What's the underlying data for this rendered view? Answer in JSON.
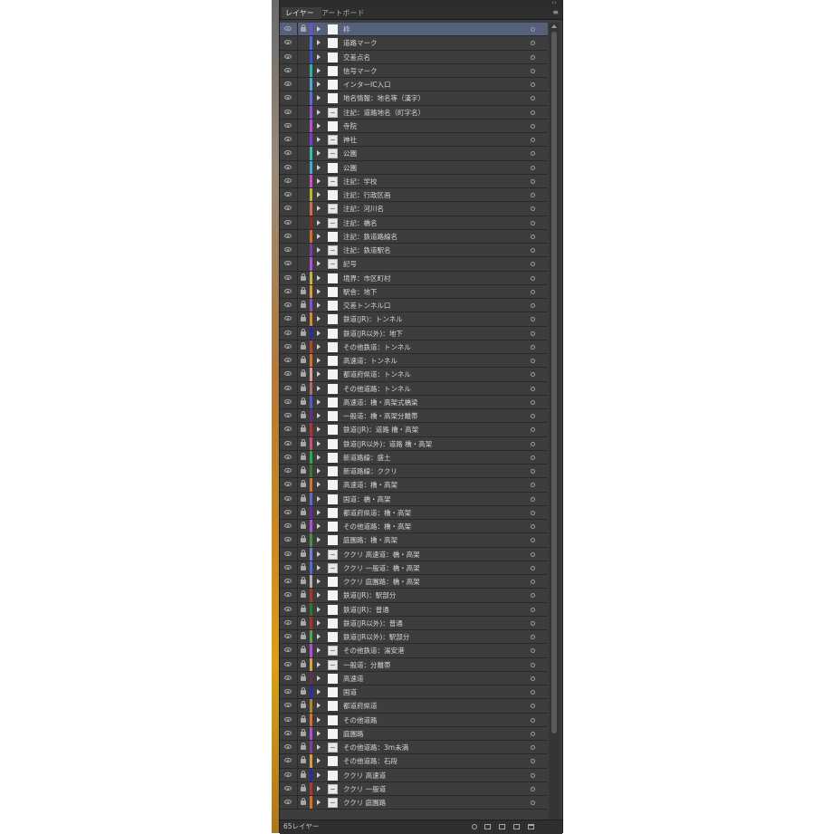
{
  "panel": {
    "tabs": [
      {
        "label": "レイヤー",
        "active": true
      },
      {
        "label": "アートボード",
        "active": false
      }
    ],
    "menu_icon": "panel-menu-icon",
    "footer": {
      "layer_count": "65レイヤー",
      "icons": [
        "search-icon",
        "clip-icon",
        "sublayer-icon",
        "new-layer-icon",
        "trash-icon"
      ]
    }
  },
  "layers": [
    {
      "name": "枠",
      "color": "#6a4fd1",
      "locked": true,
      "selected": true,
      "marked": false
    },
    {
      "name": "道路マーク",
      "color": "#4f6ad8",
      "locked": false,
      "selected": false,
      "marked": false
    },
    {
      "name": "交差点名",
      "color": "#3d4fd0",
      "locked": false,
      "selected": false,
      "marked": false
    },
    {
      "name": "信号マーク",
      "color": "#2fb5a8",
      "locked": false,
      "selected": false,
      "marked": false
    },
    {
      "name": "インターIC入口",
      "color": "#4fa5d6",
      "locked": false,
      "selected": false,
      "marked": false
    },
    {
      "name": "地名情報：地名等（漢字）",
      "color": "#5c6bd6",
      "locked": false,
      "selected": false,
      "marked": false
    },
    {
      "name": "注記：道路地名（町字名）",
      "color": "#9b4fd8",
      "locked": false,
      "selected": false,
      "marked": true
    },
    {
      "name": "寺院",
      "color": "#b74fd8",
      "locked": false,
      "selected": false,
      "marked": false
    },
    {
      "name": "神社",
      "color": "#7a3dd0",
      "locked": false,
      "selected": false,
      "marked": true
    },
    {
      "name": "公園",
      "color": "#35c0b0",
      "locked": false,
      "selected": false,
      "marked": true
    },
    {
      "name": "公園",
      "color": "#40a8d8",
      "locked": false,
      "selected": false,
      "marked": false
    },
    {
      "name": "注記：学校",
      "color": "#c84fd0",
      "locked": false,
      "selected": false,
      "marked": true
    },
    {
      "name": "注記：行政区画",
      "color": "#b8b82a",
      "locked": false,
      "selected": false,
      "marked": false
    },
    {
      "name": "注記：河川名",
      "color": "#d86a4f",
      "locked": false,
      "selected": false,
      "marked": true
    },
    {
      "name": "注記：橋名",
      "color": "#8a2a2a",
      "locked": false,
      "selected": false,
      "marked": true
    },
    {
      "name": "注記：鉄道路線名",
      "color": "#d06f2a",
      "locked": false,
      "selected": false,
      "marked": false
    },
    {
      "name": "注記：鉄道駅名",
      "color": "#7a3da0",
      "locked": false,
      "selected": false,
      "marked": true
    },
    {
      "name": "記号",
      "color": "#b04fd8",
      "locked": false,
      "selected": false,
      "marked": true
    },
    {
      "name": "境界：市区町村",
      "color": "#c8b43a",
      "locked": true,
      "selected": false,
      "marked": false
    },
    {
      "name": "駅舎：地下",
      "color": "#d89a3a",
      "locked": true,
      "selected": false,
      "marked": false
    },
    {
      "name": "交差トンネル口",
      "color": "#8a4fc0",
      "locked": true,
      "selected": false,
      "marked": false
    },
    {
      "name": "鉄道(JR)：トンネル",
      "color": "#d68a2a",
      "locked": true,
      "selected": false,
      "marked": false
    },
    {
      "name": "鉄道(JR以外)：地下",
      "color": "#2a2ab0",
      "locked": true,
      "selected": false,
      "marked": false
    },
    {
      "name": "その他鉄道：トンネル",
      "color": "#b5452a",
      "locked": true,
      "selected": false,
      "marked": false
    },
    {
      "name": "高速道：トンネル",
      "color": "#d8702a",
      "locked": true,
      "selected": false,
      "marked": false
    },
    {
      "name": "都道府県道：トンネル",
      "color": "#d89aa5",
      "locked": true,
      "selected": false,
      "marked": false
    },
    {
      "name": "その他道路：トンネル",
      "color": "#b06a6a",
      "locked": true,
      "selected": false,
      "marked": false
    },
    {
      "name": "高速道：橋・高架式橋梁",
      "color": "#4f5bd0",
      "locked": true,
      "selected": false,
      "marked": false
    },
    {
      "name": "一般道：橋・高架分離帯",
      "color": "#6a2a8a",
      "locked": true,
      "selected": false,
      "marked": false
    },
    {
      "name": "鉄道(JR)：道路 橋・高架",
      "color": "#b0342a",
      "locked": true,
      "selected": false,
      "marked": false
    },
    {
      "name": "鉄道(JR以外)：道路 橋・高架",
      "color": "#d04f7a",
      "locked": true,
      "selected": false,
      "marked": false
    },
    {
      "name": "新道路線：盛土",
      "color": "#2aa84f",
      "locked": true,
      "selected": false,
      "marked": false
    },
    {
      "name": "新道路線：ククリ",
      "color": "#3d7a2a",
      "locked": true,
      "selected": false,
      "marked": false
    },
    {
      "name": "高速道：橋・高架",
      "color": "#d8702a",
      "locked": true,
      "selected": false,
      "marked": false
    },
    {
      "name": "国道：橋・高架",
      "color": "#5a6ad0",
      "locked": true,
      "selected": false,
      "marked": false
    },
    {
      "name": "都道府県道：橋・高架",
      "color": "#6a2aa0",
      "locked": true,
      "selected": false,
      "marked": false
    },
    {
      "name": "その他道路：橋・高架",
      "color": "#b04fd0",
      "locked": true,
      "selected": false,
      "marked": false
    },
    {
      "name": "庭園路：橋・高架",
      "color": "#4f8a4f",
      "locked": true,
      "selected": false,
      "marked": false
    },
    {
      "name": "ククリ 高速道：橋・高架",
      "color": "#7a7ad8",
      "locked": true,
      "selected": false,
      "marked": true
    },
    {
      "name": "ククリ 一般道：橋・高架",
      "color": "#4f6ad0",
      "locked": true,
      "selected": false,
      "marked": true
    },
    {
      "name": "ククリ 庭園路：橋・高架",
      "color": "#b0b0b0",
      "locked": true,
      "selected": false,
      "marked": false
    },
    {
      "name": "鉄道(JR)：駅部分",
      "color": "#b0342a",
      "locked": true,
      "selected": false,
      "marked": false
    },
    {
      "name": "鉄道(JR)：普通",
      "color": "#2a7a2a",
      "locked": true,
      "selected": false,
      "marked": false
    },
    {
      "name": "鉄道(JR以外)：普通",
      "color": "#b0303a",
      "locked": true,
      "selected": false,
      "marked": false
    },
    {
      "name": "鉄道(JR以外)：駅部分",
      "color": "#4fa84f",
      "locked": true,
      "selected": false,
      "marked": false
    },
    {
      "name": "その他鉄道：湯安港",
      "color": "#b04fd8",
      "locked": true,
      "selected": false,
      "marked": true
    },
    {
      "name": "一般道：分離帯",
      "color": "#d8a53a",
      "locked": true,
      "selected": false,
      "marked": true
    },
    {
      "name": "高速道",
      "color": "#6a2a5a",
      "locked": true,
      "selected": false,
      "marked": false
    },
    {
      "name": "国道",
      "color": "#2a2ab0",
      "locked": true,
      "selected": false,
      "marked": false
    },
    {
      "name": "都道府県道",
      "color": "#b08a2a",
      "locked": true,
      "selected": false,
      "marked": false
    },
    {
      "name": "その他道路",
      "color": "#d8702a",
      "locked": true,
      "selected": false,
      "marked": false
    },
    {
      "name": "庭園路",
      "color": "#b04fd0",
      "locked": true,
      "selected": false,
      "marked": false
    },
    {
      "name": "その他道路：3m未満",
      "color": "#7a3da0",
      "locked": true,
      "selected": false,
      "marked": true
    },
    {
      "name": "その他道路：石段",
      "color": "#d89a3a",
      "locked": true,
      "selected": false,
      "marked": false
    },
    {
      "name": "ククリ 高速道",
      "color": "#2a2ab0",
      "locked": true,
      "selected": false,
      "marked": false
    },
    {
      "name": "ククリ 一般道",
      "color": "#b0343a",
      "locked": true,
      "selected": false,
      "marked": true
    },
    {
      "name": "ククリ 庭園路",
      "color": "#d8702a",
      "locked": true,
      "selected": false,
      "marked": true
    }
  ]
}
